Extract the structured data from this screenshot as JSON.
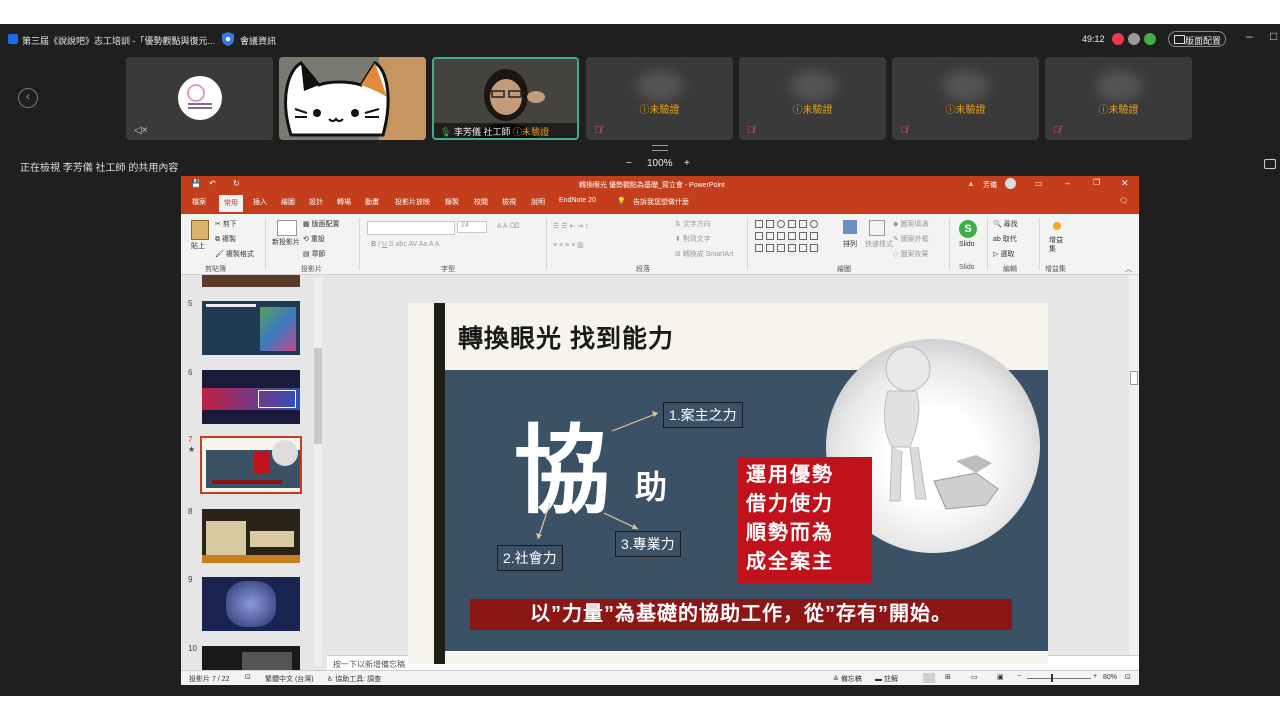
{
  "meeting": {
    "title": "第三屆《說說吧》志工培訓 -「優勢觀點與復元...",
    "info_label": "會議資訊",
    "timer": "49:12",
    "layout_button": "版面配置",
    "minimize": "–",
    "maximize": "□"
  },
  "participants": [
    {
      "name": "",
      "badge": "",
      "type": "logo"
    },
    {
      "name": "",
      "badge": "",
      "type": "cat"
    },
    {
      "name": "李芳儀 社工師",
      "badge": "未驗證",
      "type": "active"
    },
    {
      "name": "",
      "badge": "未驗證",
      "type": "blurred"
    },
    {
      "name": "",
      "badge": "未驗證",
      "type": "blurred"
    },
    {
      "name": "",
      "badge": "未驗證",
      "type": "blurred"
    },
    {
      "name": "",
      "badge": "未驗證",
      "type": "blurred"
    }
  ],
  "share": {
    "label": "正在檢視 李芳儀 社工師 的共用內容",
    "zoom": "100%",
    "zoom_minus": "−",
    "zoom_plus": "+"
  },
  "ppt": {
    "window_title": "轉換眼光 優勢觀點為基礎_寫立會 - PowerPoint",
    "user": "芳儀",
    "tabs": [
      "檔案",
      "常用",
      "插入",
      "繪圖",
      "設計",
      "轉場",
      "動畫",
      "投影片放映",
      "錄製",
      "校閱",
      "檢視",
      "說明",
      "EndNote 20"
    ],
    "tell_me": "告訴我您想做什麼",
    "ribbon": {
      "paste": "貼上",
      "cut": "剪下",
      "copy": "複製",
      "format_painter": "複製格式",
      "new_slide": "新投影片",
      "layout": "版面配置",
      "reset": "重設",
      "section": "章節",
      "font_size": "24",
      "text_direction": "文字方向",
      "align_text": "對齊文字",
      "smartart": "轉換成 SmartArt",
      "arrange": "排列",
      "quick_styles": "快速樣式",
      "shape_fill": "圖案填滿",
      "shape_outline": "圖案外框",
      "shape_effects": "圖案效果",
      "slido": "Slido",
      "find": "尋找",
      "replace": "取代",
      "select": "選取",
      "addin": "增益集",
      "groups": [
        "剪貼簿",
        "投影片",
        "字型",
        "段落",
        "繪圖",
        "Slido",
        "編輯",
        "增益集"
      ]
    },
    "thumb_numbers": [
      "5",
      "6",
      "7",
      "8",
      "9",
      "10"
    ],
    "notes_placeholder": "按一下以新增備忘稿",
    "status": {
      "slide_count": "投影片 7 / 22",
      "language": "繁體中文 (台灣)",
      "accessibility": "協助工具: 調查",
      "notes_btn": "備忘稿",
      "comments_btn": "註解",
      "zoom": "80%"
    }
  },
  "slide": {
    "title": "轉換眼光 找到能力",
    "big_char": "協",
    "small_char": "助",
    "label1": "1.案主之力",
    "label2": "2.社會力",
    "label3": "3.專業力",
    "red_lines": [
      "運用優勢",
      "借力使力",
      "順勢而為",
      "成全案主"
    ],
    "banner": "以”力量”為基礎的協助工作，從”存有”開始。"
  },
  "colors": {
    "ppt_accent": "#c43e1c",
    "slide_navy": "#3a5166",
    "slide_red": "#c1121c",
    "banner_red": "#8c1616",
    "unverified": "#e0a020"
  }
}
